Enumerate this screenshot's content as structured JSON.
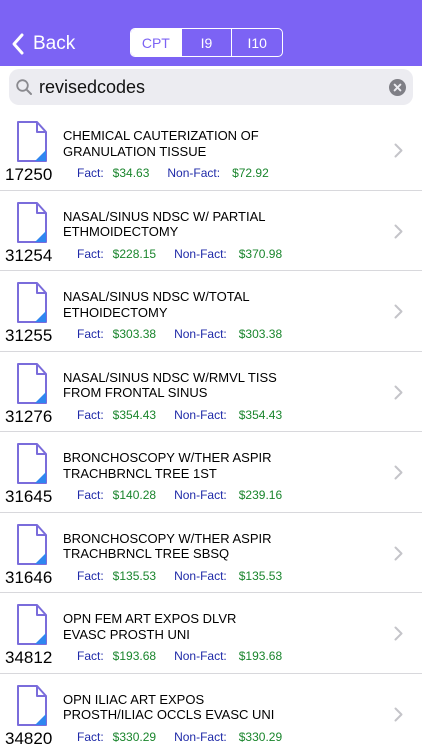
{
  "header": {
    "back_label": "Back",
    "segments": [
      {
        "label": "CPT",
        "active": true
      },
      {
        "label": "I9",
        "active": false
      },
      {
        "label": "I10",
        "active": false
      }
    ],
    "accent_color": "#7c63f4"
  },
  "search": {
    "value": "revisedcodes",
    "icon": "search-icon",
    "clear_icon": "clear-icon"
  },
  "list": {
    "fact_label": "Fact:",
    "nonfact_label": "Non-Fact:",
    "item_icon": "document-icon",
    "chevron_icon": "chevron-right-icon",
    "items": [
      {
        "code": "17250",
        "desc": "CHEMICAL CAUTERIZATION OF GRANULATION TISSUE",
        "fact": "$34.63",
        "nonfact": "$72.92"
      },
      {
        "code": "31254",
        "desc": "NASAL/SINUS NDSC W/ PARTIAL ETHMOIDECTOMY",
        "fact": "$228.15",
        "nonfact": "$370.98"
      },
      {
        "code": "31255",
        "desc": "NASAL/SINUS NDSC W/TOTAL ETHOIDECTOMY",
        "fact": "$303.38",
        "nonfact": "$303.38"
      },
      {
        "code": "31276",
        "desc": "NASAL/SINUS NDSC W/RMVL TISS FROM FRONTAL SINUS",
        "fact": "$354.43",
        "nonfact": "$354.43"
      },
      {
        "code": "31645",
        "desc": "BRONCHOSCOPY W/THER ASPIR TRACHBRNCL TREE 1ST",
        "fact": "$140.28",
        "nonfact": "$239.16"
      },
      {
        "code": "31646",
        "desc": "BRONCHOSCOPY W/THER ASPIR TRACHBRNCL TREE SBSQ",
        "fact": "$135.53",
        "nonfact": "$135.53"
      },
      {
        "code": "34812",
        "desc": "OPN FEM ART EXPOS DLVR EVASC PROSTH UNI",
        "fact": "$193.68",
        "nonfact": "$193.68"
      },
      {
        "code": "34820",
        "desc": "OPN ILIAC ART EXPOS PROSTH/ILIAC OCCLS EVASC UNI",
        "fact": "$330.29",
        "nonfact": "$330.29"
      }
    ]
  }
}
